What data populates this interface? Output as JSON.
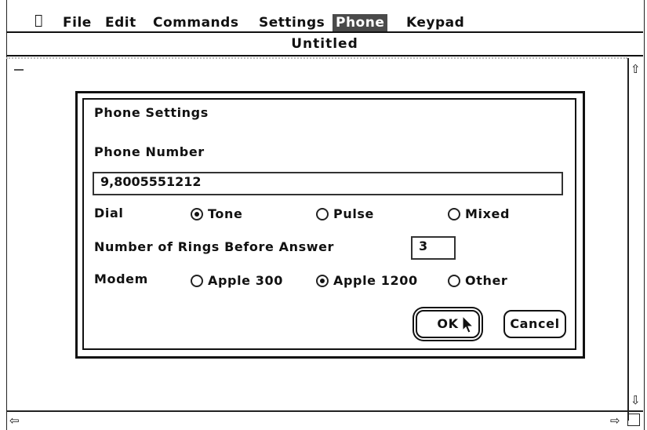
{
  "menubar": {
    "apple_icon": "apple-icon",
    "items": [
      "File",
      "Edit",
      "Commands",
      "Settings",
      "Phone",
      "Keypad"
    ],
    "active_item": "Phone"
  },
  "window": {
    "title": "Untitled"
  },
  "dialog": {
    "title": "Phone Settings",
    "phone_number_label": "Phone Number",
    "phone_number_value": "9,8005551212",
    "dial_label": "Dial",
    "dial_options": [
      "Tone",
      "Pulse",
      "Mixed"
    ],
    "dial_selected": "Tone",
    "rings_label": "Number of Rings Before Answer",
    "rings_value": "3",
    "modem_label": "Modem",
    "modem_options": [
      "Apple 300",
      "Apple 1200",
      "Other"
    ],
    "modem_selected": "Apple 1200",
    "ok_label": "OK",
    "cancel_label": "Cancel"
  }
}
